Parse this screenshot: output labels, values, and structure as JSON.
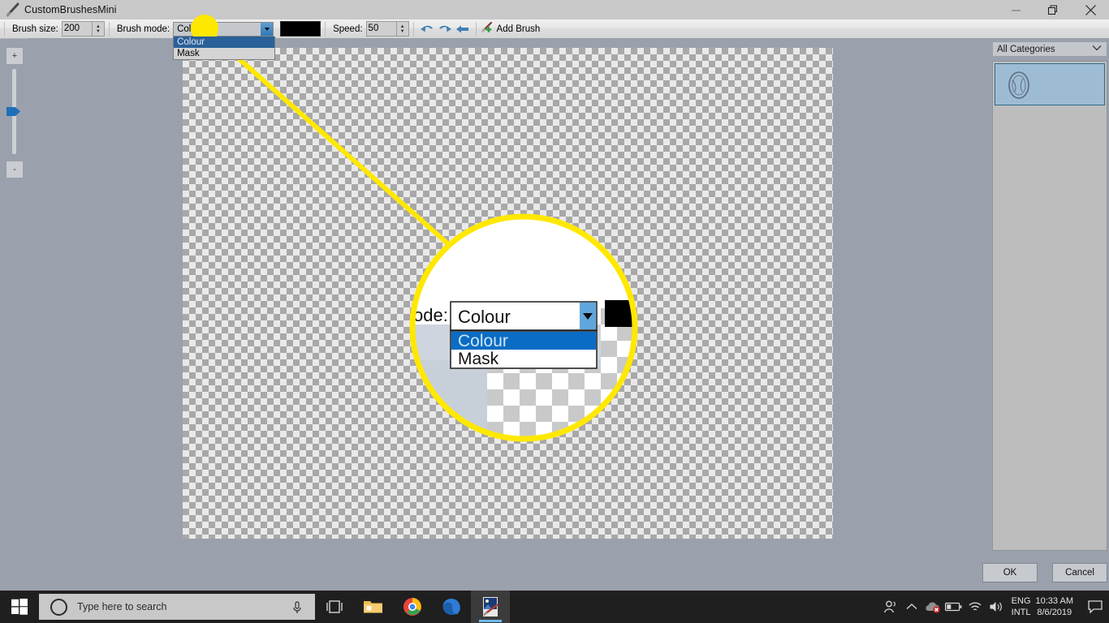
{
  "window": {
    "title": "CustomBrushesMini",
    "icon": "brush-icon",
    "minimize_label": "Minimize",
    "restore_label": "Restore",
    "close_label": "Close"
  },
  "toolbar": {
    "brush_size_label": "Brush size:",
    "brush_size_value": "200",
    "brush_mode_label": "Brush mode:",
    "brush_mode_value": "Colour",
    "brush_mode_options": [
      "Colour",
      "Mask"
    ],
    "brush_mode_selected_index": 0,
    "color_swatch": "#000000",
    "speed_label": "Speed:",
    "speed_value": "50",
    "undo_label": "Undo",
    "redo_label": "Redo",
    "back_label": "Back",
    "add_brush_label": "Add Brush"
  },
  "zoom_slider": {
    "plus_label": "+",
    "minus_label": "-"
  },
  "right_panel": {
    "category_value": "All Categories",
    "category_options": [
      "All Categories"
    ],
    "brush_items": [
      {
        "name": "brush-thumbnail-1",
        "selected": true
      }
    ]
  },
  "dialog_buttons": {
    "ok_label": "OK",
    "cancel_label": "Cancel"
  },
  "callout": {
    "line_color": "#FFE800",
    "circle_fill": "#FFFFFF",
    "circle_stroke": "#FFE800",
    "magnified": {
      "field_label": "ode:",
      "combo_value": "Colour",
      "options": [
        "Colour",
        "Mask"
      ],
      "selected_index": 0,
      "swatch_color": "#000000"
    }
  },
  "taskbar": {
    "start_label": "Start",
    "search_placeholder": "Type here to search",
    "mic_label": "Cortana microphone",
    "taskview_label": "Task View",
    "apps": [
      {
        "name": "file-explorer-icon",
        "active": false
      },
      {
        "name": "chrome-icon",
        "active": false
      },
      {
        "name": "edge-icon",
        "active": false
      },
      {
        "name": "paint-shop-pro-icon",
        "active": true
      }
    ],
    "tray": {
      "people_label": "People",
      "show_hidden_label": "Show hidden icons",
      "onedrive_label": "OneDrive",
      "battery_label": "Battery",
      "network_label": "Network",
      "volume_label": "Volume",
      "language_line1": "ENG",
      "language_line2": "INTL",
      "time": "10:33 AM",
      "date": "8/6/2019",
      "action_center_label": "Action Center"
    }
  },
  "colors": {
    "accent_blue": "#2a6099",
    "highlight_blue": "#0a6cc4",
    "canvas_bg": "#9aa1ac",
    "toolbar_bg": "#e6e6e6",
    "taskbar_bg": "#1f1f1f"
  }
}
